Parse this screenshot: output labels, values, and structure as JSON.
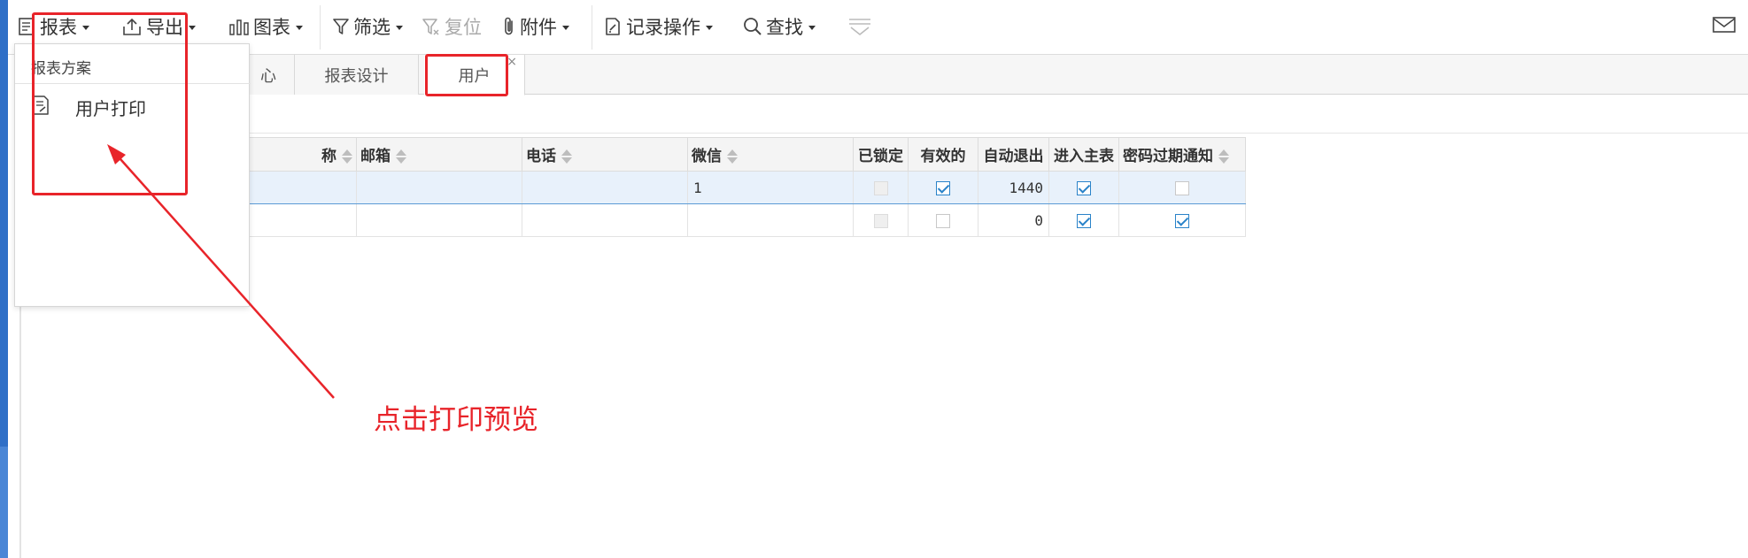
{
  "toolbar": {
    "report": "报表",
    "export": "导出",
    "chart": "图表",
    "filter": "筛选",
    "reset": "复位",
    "attachment": "附件",
    "record_ops": "记录操作",
    "find": "查找"
  },
  "tabs": [
    {
      "label": "心"
    },
    {
      "label": "报表设计"
    },
    {
      "label": "用户",
      "close": "×"
    }
  ],
  "dropdown": {
    "title": "报表方案",
    "item": "用户打印"
  },
  "grid": {
    "columns": [
      "称",
      "邮箱",
      "电话",
      "微信",
      "已锁定",
      "有效的",
      "自动退出",
      "进入主表",
      "密码过期通知"
    ],
    "rows": [
      {
        "name": "",
        "email": "",
        "phone": "",
        "wechat": "1",
        "locked": false,
        "valid": true,
        "auto_logout": "1440",
        "enter_main": true,
        "pwd_notice": false,
        "selected": true
      },
      {
        "name": "",
        "email": "",
        "phone": "",
        "wechat": "",
        "locked": false,
        "valid": false,
        "auto_logout": "0",
        "enter_main": true,
        "pwd_notice": true,
        "selected": false
      }
    ]
  },
  "annotation": {
    "text": "点击打印预览"
  },
  "colors": {
    "accent": "#2a83c9",
    "annotation_red": "#e8242a",
    "left_strip": "#2f6fc7"
  }
}
